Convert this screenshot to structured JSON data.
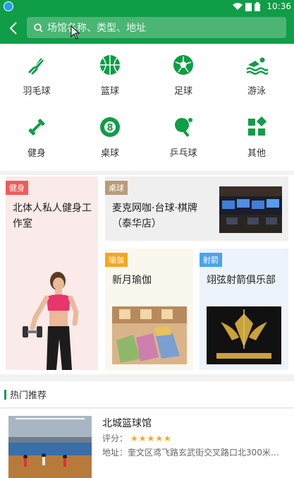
{
  "status_bar": {
    "time": "10:36"
  },
  "header": {
    "search_placeholder": "场馆名称、类型、地址"
  },
  "categories": [
    {
      "label": "羽毛球",
      "icon": "shuttlecock-icon"
    },
    {
      "label": "篮球",
      "icon": "basketball-icon"
    },
    {
      "label": "足球",
      "icon": "soccer-ball-icon"
    },
    {
      "label": "游泳",
      "icon": "swimming-icon"
    },
    {
      "label": "健身",
      "icon": "dumbbell-icon"
    },
    {
      "label": "桌球",
      "icon": "billiard-ball-icon"
    },
    {
      "label": "乒乓球",
      "icon": "ping-pong-icon"
    },
    {
      "label": "其他",
      "icon": "grid-icon"
    }
  ],
  "cards": {
    "fitness": {
      "tag": "健身",
      "title": "北体人私人健身工作室",
      "tag_color": "#f15b5b"
    },
    "billiards": {
      "tag": "桌球",
      "title": "麦克网咖·台球·棋牌（泰华店）",
      "tag_color": "#b89b7a"
    },
    "yoga": {
      "tag": "瑜伽",
      "title": "新月瑜伽",
      "tag_color": "#f5a623"
    },
    "archery": {
      "tag": "射箭",
      "title": "翊弦射箭俱乐部",
      "tag_color": "#4aa3f0",
      "logo_text": "WEIFANG FLYING STRING ARCHERY CLUB"
    }
  },
  "hot": {
    "section_title": "热门推荐",
    "items": [
      {
        "name": "北城篮球馆",
        "rating_label": "评分：",
        "stars": "★★★★★",
        "address": "地址：奎文区鸢飞路玄武街交叉路口北300米路..."
      }
    ]
  },
  "colors": {
    "brand": "#0f9d47"
  }
}
